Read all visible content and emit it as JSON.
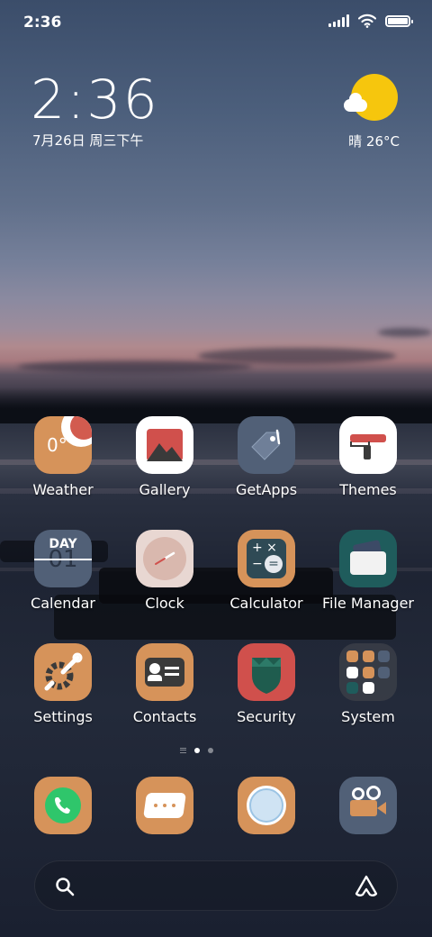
{
  "status_bar": {
    "time": "2:36"
  },
  "clock_widget": {
    "time": "2:36",
    "date": "7月26日 周三下午"
  },
  "weather_widget": {
    "condition_icon": "sun-cloud-icon",
    "temperature": "晴 26°C"
  },
  "apps": [
    {
      "label": "Weather",
      "icon": "weather-icon",
      "icon_text": "0°"
    },
    {
      "label": "Gallery",
      "icon": "gallery-icon"
    },
    {
      "label": "GetApps",
      "icon": "getapps-icon"
    },
    {
      "label": "Themes",
      "icon": "themes-icon"
    },
    {
      "label": "Calendar",
      "icon": "calendar-icon",
      "icon_top": "DAY",
      "icon_bottom": "01"
    },
    {
      "label": "Clock",
      "icon": "clock-icon"
    },
    {
      "label": "Calculator",
      "icon": "calculator-icon"
    },
    {
      "label": "File Manager",
      "icon": "file-manager-icon"
    },
    {
      "label": "Settings",
      "icon": "settings-icon"
    },
    {
      "label": "Contacts",
      "icon": "contacts-icon"
    },
    {
      "label": "Security",
      "icon": "security-icon"
    },
    {
      "label": "System",
      "icon": "system-folder-icon"
    }
  ],
  "page_indicator": {
    "pages": 2,
    "current": 1
  },
  "dock": [
    {
      "icon": "phone-icon"
    },
    {
      "icon": "messages-icon"
    },
    {
      "icon": "browser-icon"
    },
    {
      "icon": "camera-icon"
    }
  ],
  "colors": {
    "icon_orange": "#d6935a",
    "sun_yellow": "#f6c60d",
    "phone_green": "#2fc66b",
    "security_red": "#d0504c"
  }
}
